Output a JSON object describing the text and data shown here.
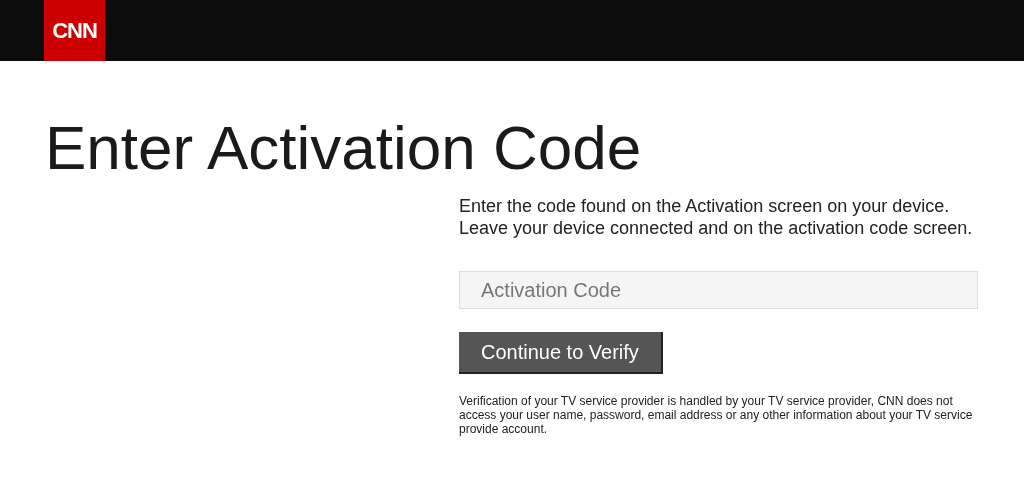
{
  "header": {
    "logo": "CNN"
  },
  "title": "Enter Activation Code",
  "instructions": "Enter the code found on the Activation screen on your device. Leave your device connected and on the activation code screen.",
  "code_field": {
    "placeholder": "Activation Code"
  },
  "submit_button": "Continue to Verify",
  "disclaimer": "Verification of your TV service provider is handled by your TV service provider, CNN does not access your user name, password, email address or any other information about your TV service provide account."
}
